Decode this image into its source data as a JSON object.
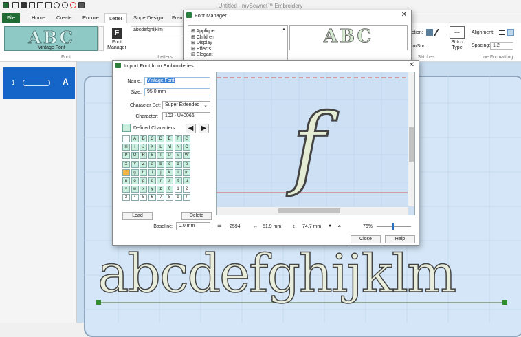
{
  "app": {
    "title": "Untitled - mySewnet™ Embroidery"
  },
  "tabs": [
    "File",
    "Home",
    "Create",
    "Encore",
    "Letter",
    "SuperDesign",
    "Fram"
  ],
  "ribbon": {
    "font_name": "Vintage Font",
    "font_group": "Font",
    "font_manager": "Font\nManager",
    "letters_value": "abcdefghijklm",
    "letters_group": "Letters",
    "gallery_sample": "ABC",
    "direction_label": "ection:",
    "colorsort": "olorSort",
    "stitches_group": "Stitches",
    "stitch_type": "Stitch\nType",
    "alignment_label": "Alignment:",
    "spacing_label": "Spacing:",
    "spacing_value": "1.2",
    "line_formatting_group": "Line Formatting"
  },
  "left_panel": {
    "item_number": "1",
    "item_letter": "A"
  },
  "font_manager": {
    "title": "Font Manager",
    "tree": [
      "Applique",
      "Children",
      "Display",
      "Effects",
      "Elegant"
    ],
    "preview_sample": "ABC"
  },
  "import_dialog": {
    "title": "Import Font from Embroideries",
    "name_label": "Name:",
    "name_value": "Vintage Font",
    "size_label": "Size:",
    "size_value": "95.0 mm",
    "charset_label": "Character Set:",
    "charset_value": "Super Extended",
    "character_label": "Character:",
    "character_value": "102 - U+0066",
    "defined_label": "Defined Characters",
    "grid": [
      "",
      "A",
      "B",
      "C",
      "D",
      "E",
      "F",
      "G",
      "H",
      "I",
      "J",
      "K",
      "L",
      "M",
      "N",
      "O",
      "P",
      "Q",
      "R",
      "S",
      "T",
      "U",
      "V",
      "W",
      "X",
      "Y",
      "Z",
      "a",
      "b",
      "c",
      "d",
      "e",
      "f",
      "g",
      "h",
      "i",
      "j",
      "k",
      "l",
      "m",
      "n",
      "o",
      "p",
      "q",
      "r",
      "s",
      "t",
      "u",
      "v",
      "w",
      "x",
      "y",
      "z",
      "0",
      "1",
      "2",
      "3",
      "4",
      "5",
      "6",
      "7",
      "8",
      "9",
      "!"
    ],
    "load": "Load",
    "delete": "Delete",
    "baseline_label": "Baseline:",
    "baseline_value": "0.0 mm",
    "stitches": "2594",
    "width": "51.9 mm",
    "height": "74.7 mm",
    "colors": "4",
    "zoom": "76%",
    "close": "Close",
    "help": "Help",
    "preview_char": "f"
  },
  "canvas": {
    "text": "abcdefghijklm"
  },
  "colors": {
    "accent": "#1e6b34",
    "selection": "#1565c8",
    "canvas": "#c9ddf0"
  }
}
